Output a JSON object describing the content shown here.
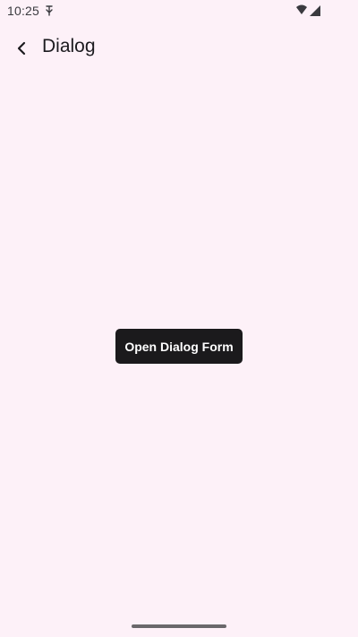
{
  "status_bar": {
    "time": "10:25",
    "notification_icon": "usb-debug-icon",
    "wifi_icon": "wifi-icon",
    "signal_icon": "cell-signal-icon"
  },
  "app_bar": {
    "back_icon": "chevron-left-icon",
    "title": "Dialog"
  },
  "main": {
    "open_dialog_button_label": "Open Dialog Form"
  },
  "colors": {
    "background": "#fdf1f8",
    "button_bg": "#1b1a1c",
    "button_text": "#ffffff"
  }
}
